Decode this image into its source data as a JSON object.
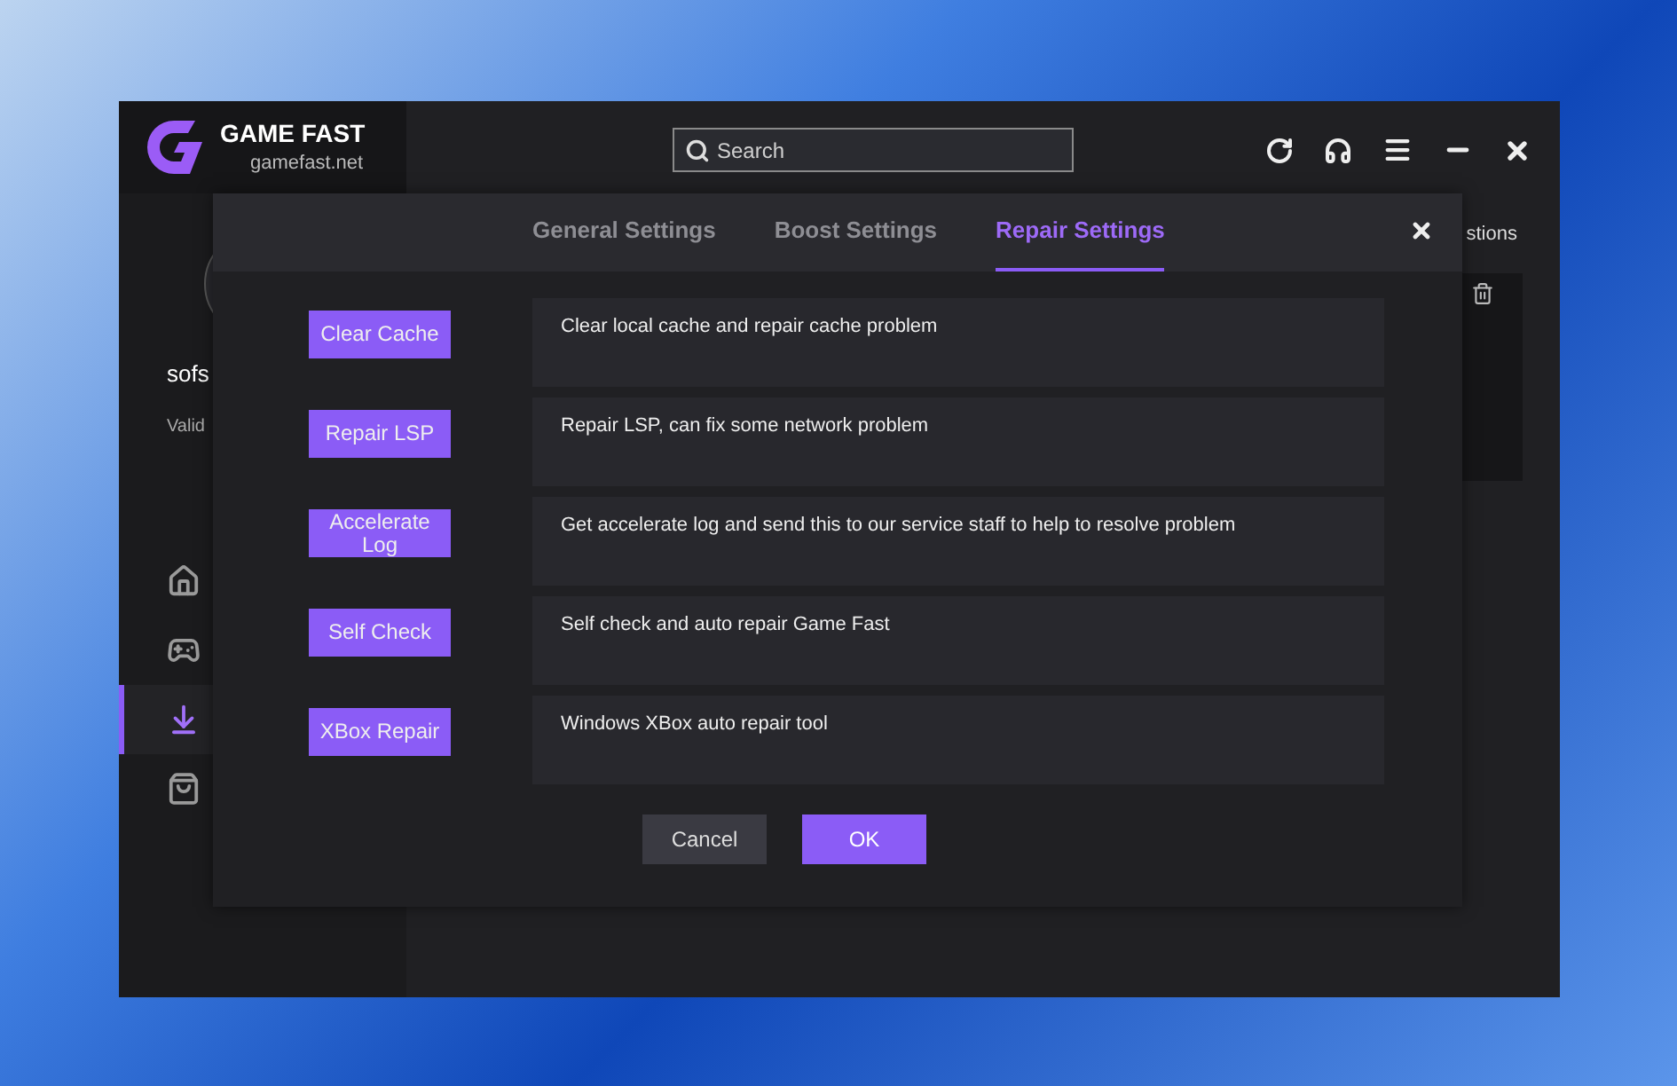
{
  "app": {
    "title": "GAME FAST",
    "subtitle": "gamefast.net",
    "search": {
      "placeholder": "Search"
    },
    "user": {
      "name": "sofs",
      "status": "Valid"
    },
    "sidebar": {
      "items": [
        {
          "kind": "home",
          "selected": false
        },
        {
          "kind": "games",
          "selected": false
        },
        {
          "kind": "downloads",
          "selected": true
        },
        {
          "kind": "store",
          "selected": false
        }
      ]
    },
    "panel_heading": "stions"
  },
  "dialog": {
    "tabs": [
      {
        "label": "General Settings",
        "selected": false
      },
      {
        "label": "Boost Settings",
        "selected": false
      },
      {
        "label": "Repair Settings",
        "selected": true
      }
    ],
    "actions": [
      {
        "button": "Clear Cache",
        "description": "Clear local cache and repair cache problem"
      },
      {
        "button": "Repair LSP",
        "description": "Repair LSP, can fix some network problem"
      },
      {
        "button": "Accelerate Log",
        "description": "Get accelerate log and send this to our service staff to help to resolve problem"
      },
      {
        "button": "Self Check",
        "description": "Self check and auto repair Game Fast"
      },
      {
        "button": "XBox Repair",
        "description": "Windows XBox auto repair tool"
      }
    ],
    "buttons": [
      {
        "label": "Cancel",
        "kind": "secondary"
      },
      {
        "label": "OK",
        "kind": "primary"
      }
    ]
  }
}
